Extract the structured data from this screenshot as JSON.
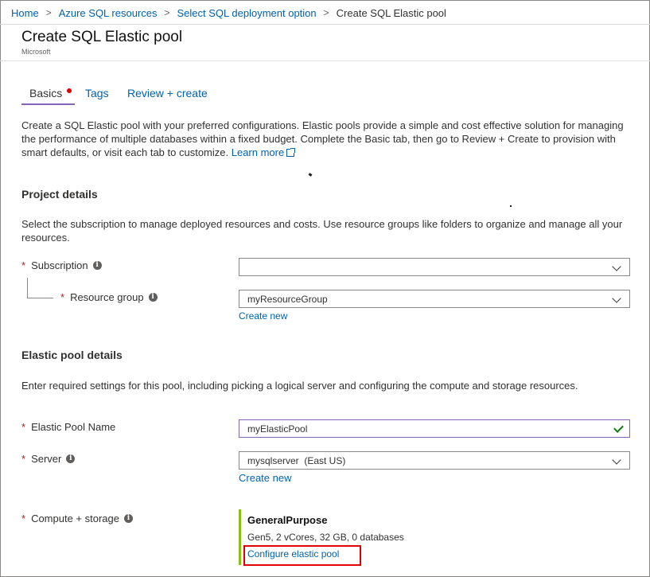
{
  "breadcrumb": {
    "items": [
      "Home",
      "Azure SQL resources",
      "Select SQL deployment option"
    ],
    "separator": ">",
    "current": "Create SQL Elastic pool"
  },
  "header": {
    "title": "Create SQL Elastic pool",
    "publisher": "Microsoft"
  },
  "tabs": [
    {
      "label": "Basics",
      "active": true,
      "has_error_dot": true
    },
    {
      "label": "Tags",
      "active": false
    },
    {
      "label": "Review + create",
      "active": false
    }
  ],
  "intro": {
    "text": "Create a SQL Elastic pool with your preferred configurations. Elastic pools provide a simple and cost effective solution for managing the performance of multiple databases within a fixed budget. Complete the Basic tab, then go to Review + Create to provision with smart defaults, or visit each tab to customize. ",
    "learn_more": "Learn more"
  },
  "project_details": {
    "title": "Project details",
    "description": "Select the subscription to manage deployed resources and costs. Use resource groups like folders to organize and manage all your resources.",
    "subscription": {
      "label": "Subscription",
      "value": ""
    },
    "resource_group": {
      "label": "Resource group",
      "value": "myResourceGroup",
      "create_new": "Create new"
    }
  },
  "pool_details": {
    "title": "Elastic pool details",
    "description": "Enter required settings for this pool, including picking a logical server and configuring the compute and storage resources.",
    "pool_name": {
      "label": "Elastic Pool Name",
      "value": "myElasticPool"
    },
    "server": {
      "label": "Server",
      "value": "mysqlserver  (East US)",
      "create_new": "Create new"
    },
    "compute": {
      "label": "Compute + storage",
      "tier": "GeneralPurpose",
      "summary": "Gen5, 2 vCores, 32 GB, 0 databases",
      "configure_link": "Configure elastic pool"
    }
  },
  "required_marker": "*",
  "colors": {
    "link": "#0062ad",
    "accent_purple": "#8764b8",
    "required_red": "#a4262c",
    "compute_bar_green": "#8cbd18",
    "highlight_red": "#e00000"
  }
}
